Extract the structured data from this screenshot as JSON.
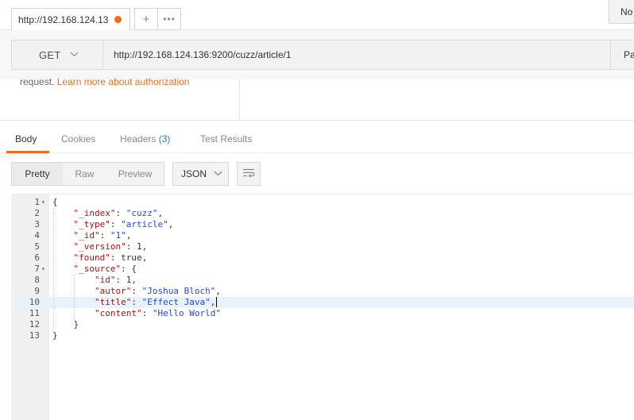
{
  "tabs": {
    "active_title": "http://192.168.124.13",
    "more_label": "•••",
    "plus_label": "+",
    "environment": "No"
  },
  "request": {
    "method": "GET",
    "url": "http://192.168.124.136:9200/cuzz/article/1",
    "params_label": "Pa"
  },
  "auth": {
    "prefix": "request. ",
    "link": "Learn more about authorization"
  },
  "response_tabs": [
    {
      "label": "Body",
      "active": true
    },
    {
      "label": "Cookies"
    },
    {
      "label": "Headers",
      "count": "(3)"
    },
    {
      "label": "Test Results"
    }
  ],
  "toolbar": {
    "views": [
      "Pretty",
      "Raw",
      "Preview"
    ],
    "active_view": "Pretty",
    "format": "JSON"
  },
  "editor": {
    "current_line": 10,
    "lines": [
      {
        "num": "1",
        "fold": true,
        "indent": "",
        "parts": [
          [
            "n",
            "{"
          ]
        ]
      },
      {
        "num": "2",
        "indent": "    ",
        "parts": [
          [
            "k",
            "\"_index\""
          ],
          [
            "n",
            ": "
          ],
          [
            "s",
            "\"cuzz\""
          ],
          [
            "n",
            ","
          ]
        ]
      },
      {
        "num": "3",
        "indent": "    ",
        "parts": [
          [
            "k",
            "\"_type\""
          ],
          [
            "n",
            ": "
          ],
          [
            "s",
            "\"article\""
          ],
          [
            "n",
            ","
          ]
        ]
      },
      {
        "num": "4",
        "indent": "    ",
        "parts": [
          [
            "k",
            "\"_id\""
          ],
          [
            "n",
            ": "
          ],
          [
            "s",
            "\"1\""
          ],
          [
            "n",
            ","
          ]
        ]
      },
      {
        "num": "5",
        "indent": "    ",
        "parts": [
          [
            "k",
            "\"_version\""
          ],
          [
            "n",
            ": 1,"
          ]
        ]
      },
      {
        "num": "6",
        "indent": "    ",
        "parts": [
          [
            "k",
            "\"found\""
          ],
          [
            "n",
            ": true,"
          ]
        ]
      },
      {
        "num": "7",
        "fold": true,
        "indent": "    ",
        "parts": [
          [
            "k",
            "\"_source\""
          ],
          [
            "n",
            ": {"
          ]
        ]
      },
      {
        "num": "8",
        "indent": "        ",
        "parts": [
          [
            "k",
            "\"id\""
          ],
          [
            "n",
            ": 1,"
          ]
        ]
      },
      {
        "num": "9",
        "indent": "        ",
        "parts": [
          [
            "k",
            "\"autor\""
          ],
          [
            "n",
            ": "
          ],
          [
            "s",
            "\"Joshua Bloch\""
          ],
          [
            "n",
            ","
          ]
        ]
      },
      {
        "num": "10",
        "indent": "        ",
        "parts": [
          [
            "k",
            "\"title\""
          ],
          [
            "n",
            ": "
          ],
          [
            "s",
            "\"Effect Java\""
          ],
          [
            "n",
            ","
          ]
        ]
      },
      {
        "num": "11",
        "indent": "        ",
        "parts": [
          [
            "k",
            "\"content\""
          ],
          [
            "n",
            ": "
          ],
          [
            "s",
            "\"Hello World\""
          ]
        ]
      },
      {
        "num": "12",
        "indent": "    ",
        "parts": [
          [
            "n",
            "}"
          ]
        ]
      },
      {
        "num": "13",
        "indent": "",
        "parts": [
          [
            "n",
            "}"
          ]
        ]
      }
    ]
  },
  "colors": {
    "accent": "#f26b1d",
    "count": "#2a7ad4",
    "key": "#a31515",
    "string": "#2549d0"
  }
}
